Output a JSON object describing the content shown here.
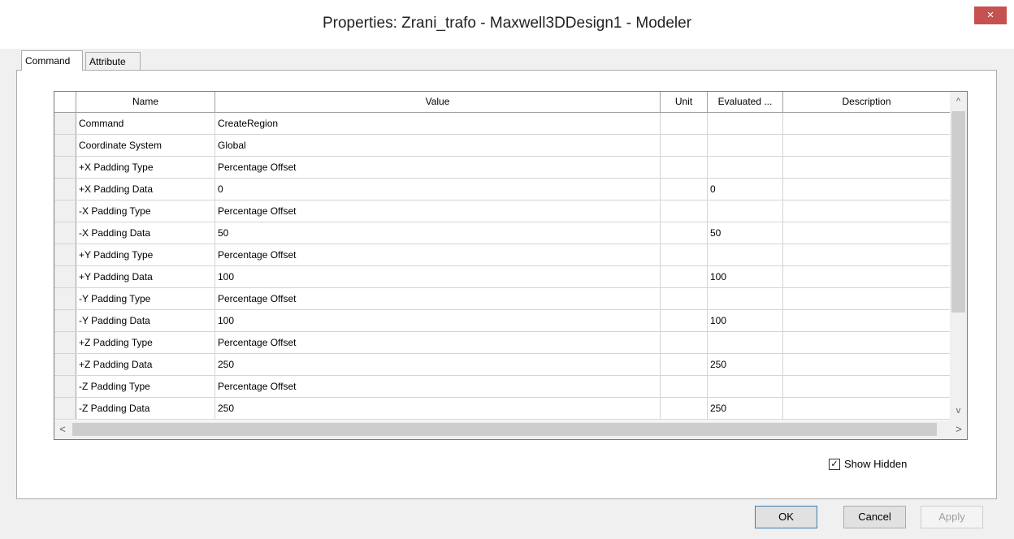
{
  "window": {
    "title": "Properties: Zrani_trafo - Maxwell3DDesign1 - Modeler",
    "close_glyph": "×"
  },
  "tabs": [
    {
      "label": "Command",
      "active": true
    },
    {
      "label": "Attribute",
      "active": false
    }
  ],
  "grid": {
    "columns": [
      "Name",
      "Value",
      "Unit",
      "Evaluated ...",
      "Description"
    ],
    "rows": [
      {
        "name": "Command",
        "value": "CreateRegion",
        "unit": "",
        "evaluated": "",
        "description": ""
      },
      {
        "name": "Coordinate System",
        "value": "Global",
        "unit": "",
        "evaluated": "",
        "description": ""
      },
      {
        "name": "+X Padding Type",
        "value": "Percentage Offset",
        "unit": "",
        "evaluated": "",
        "description": ""
      },
      {
        "name": "+X Padding Data",
        "value": "0",
        "unit": "",
        "evaluated": "0",
        "description": ""
      },
      {
        "name": "-X Padding Type",
        "value": "Percentage Offset",
        "unit": "",
        "evaluated": "",
        "description": ""
      },
      {
        "name": "-X Padding Data",
        "value": "50",
        "unit": "",
        "evaluated": "50",
        "description": ""
      },
      {
        "name": "+Y Padding Type",
        "value": "Percentage Offset",
        "unit": "",
        "evaluated": "",
        "description": ""
      },
      {
        "name": "+Y Padding Data",
        "value": "100",
        "unit": "",
        "evaluated": "100",
        "description": ""
      },
      {
        "name": "-Y Padding Type",
        "value": "Percentage Offset",
        "unit": "",
        "evaluated": "",
        "description": ""
      },
      {
        "name": "-Y Padding Data",
        "value": "100",
        "unit": "",
        "evaluated": "100",
        "description": ""
      },
      {
        "name": "+Z Padding Type",
        "value": "Percentage Offset",
        "unit": "",
        "evaluated": "",
        "description": ""
      },
      {
        "name": "+Z Padding Data",
        "value": "250",
        "unit": "",
        "evaluated": "250",
        "description": ""
      },
      {
        "name": "-Z Padding Type",
        "value": "Percentage Offset",
        "unit": "",
        "evaluated": "",
        "description": ""
      },
      {
        "name": "-Z Padding Data",
        "value": "250",
        "unit": "",
        "evaluated": "250",
        "description": ""
      }
    ]
  },
  "scroll_glyphs": {
    "up": "^",
    "down": "v",
    "left": "<",
    "right": ">"
  },
  "show_hidden": {
    "label": "Show Hidden",
    "checked": true,
    "mark": "✓"
  },
  "buttons": {
    "ok": "OK",
    "cancel": "Cancel",
    "apply": "Apply"
  },
  "colors": {
    "close_button": "#c75050",
    "ok_border": "#3c7fb1"
  }
}
